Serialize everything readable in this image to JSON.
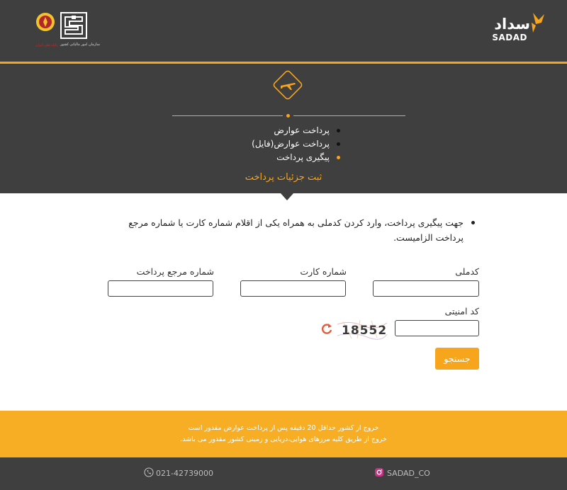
{
  "header": {
    "brand_fa": "سداد",
    "brand_en": "SADAD",
    "cbi_caption": "سازمان امور مالیاتی کشور",
    "bank_caption": "بانک ملی ایران"
  },
  "menu": {
    "items": [
      {
        "label": "پرداخت عوارض",
        "active": false
      },
      {
        "label": "پرداخت عوارض(فایل)",
        "active": false
      },
      {
        "label": "پیگیری پرداخت",
        "active": true
      }
    ]
  },
  "section_title": "ثبت جزئیات پرداخت",
  "note": "جهت پیگیری پرداخت، وارد کردن کدملی به همراه یکی از اقلام شماره کارت یا شماره مرجع پرداخت الزامیست.",
  "form": {
    "national_code_label": "کدملی",
    "card_number_label": "شماره کارت",
    "reference_label": "شماره مرجع پرداخت",
    "security_code_label": "کد امنیتی",
    "captcha_text": "18552",
    "search_label": "جستجو"
  },
  "notice": {
    "line1": "خروج از کشور حداقل 20 دقیقه پس از پرداخت عوارض مقدور است",
    "line2": "خروج از طریق کلیه مرزهای هوایی،دریایی و زمینی کشور مقدور می باشد."
  },
  "footer": {
    "phone": "021-42739000",
    "instagram": "SADAD_CO"
  },
  "colors": {
    "accent": "#f7a51c",
    "dark": "#403f3f"
  }
}
